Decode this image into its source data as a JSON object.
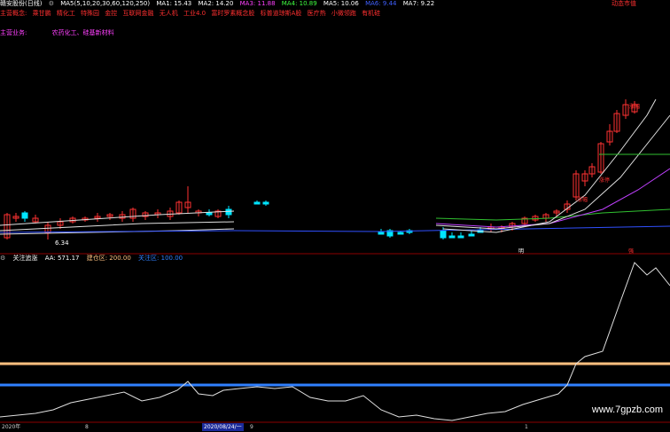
{
  "header": {
    "title": "赣安股份(日线)",
    "ma_params": "MA5(5,10,20,30,60,120,250)",
    "ma": [
      {
        "label": "MA1: 15.43",
        "color": "#ffffff"
      },
      {
        "label": "MA2: 14.20",
        "color": "#ffffff"
      },
      {
        "label": "MA3: 11.88",
        "color": "#ff40ff"
      },
      {
        "label": "MA4: 10.89",
        "color": "#40ff40"
      },
      {
        "label": "MA5: 10.06",
        "color": "#ffffff"
      },
      {
        "label": "MA6: 9.44",
        "color": "#4060ff"
      },
      {
        "label": "MA7: 9.22",
        "color": "#ffffff"
      }
    ],
    "right_label": "动态市值"
  },
  "concept_line": {
    "label": "主营概念:",
    "items": [
      "乘甘鹏",
      "精化工",
      "特殊园",
      "金控",
      "互联网金融",
      "无人机",
      "工业4.0",
      "富时罗素概念股",
      "标普道琼斯A股",
      "医疗热",
      "小微领跑",
      "有机硅"
    ]
  },
  "business_line": {
    "label": "主营业务:",
    "text": "农药化工、硅基新材料"
  },
  "annotations": {
    "low_price": "6.34",
    "rise_label_1": "涨幅",
    "rise_label_2": "涨停",
    "rise_label_3": "涨幅",
    "marker_1": "明",
    "marker_2": "强"
  },
  "indicator": {
    "name": "关注追涨",
    "aa": "AA: 571.17",
    "build_zone": "建仓区: 200.00",
    "watch_zone": "关注区: 100.00"
  },
  "axis": {
    "labels": [
      "2020年",
      "8",
      "2020/08/24/一",
      "9",
      "1"
    ]
  },
  "watermark": "www.7gpzb.com",
  "colors": {
    "up": "#ff3232",
    "down": "#00e5ff",
    "ma_white": "#e0e0e0",
    "ma_magenta": "#c040ff",
    "ma_green": "#30c030",
    "ma_blue": "#3050ff",
    "build_line": "#ffc080",
    "watch_line": "#3080ff"
  }
}
